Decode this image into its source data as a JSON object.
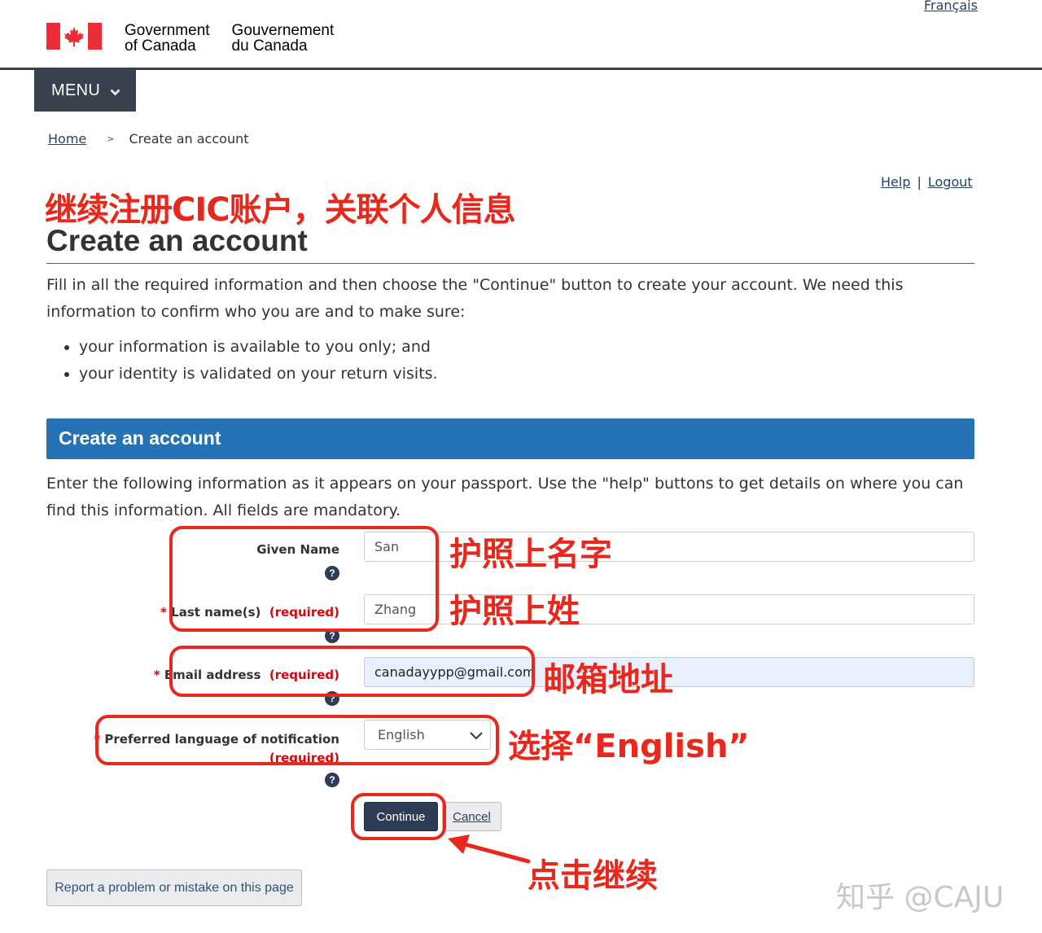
{
  "header": {
    "language_link": "Français",
    "gov_en_line1": "Government",
    "gov_en_line2": "of Canada",
    "gov_fr_line1": "Gouvernement",
    "gov_fr_line2": "du Canada",
    "menu_label": "MENU"
  },
  "breadcrumb": {
    "home": "Home",
    "separator": ">",
    "current": "Create an account"
  },
  "top_links": {
    "help": "Help",
    "separator": "|",
    "logout": "Logout"
  },
  "annotations": {
    "title": "继续注册CIC账户，关联个人信息",
    "given_name": "护照上名字",
    "last_name": "护照上姓",
    "email": "邮箱地址",
    "language": "选择“English”",
    "continue": "点击继续",
    "watermark": "知乎 @CAJU",
    "color": "#e8281c"
  },
  "page": {
    "title": "Create an account",
    "intro": "Fill in all the required information and then choose the \"Continue\" button to create your account. We need this information to confirm who you are and to make sure:",
    "bullets": [
      "your information is available to you only; and",
      "your identity is validated on your return visits."
    ]
  },
  "panel": {
    "heading": "Create an account",
    "intro": "Enter the following information as it appears on your passport. Use the \"help\" buttons to get details on where you can find this information. All fields are mandatory."
  },
  "form": {
    "required_star": "*",
    "required_text": "(required)",
    "given_name": {
      "label": "Given Name",
      "value": "San"
    },
    "last_name": {
      "label": "Last name(s)",
      "value": "Zhang"
    },
    "email": {
      "label": "Email address",
      "value": "canadayypp@gmail.com"
    },
    "language": {
      "label": "Preferred language of notification",
      "selected": "English"
    },
    "help_glyph": "?",
    "continue_label": "Continue",
    "cancel_label": "Cancel"
  },
  "footer": {
    "report_label": "Report a problem or mistake on this page"
  }
}
